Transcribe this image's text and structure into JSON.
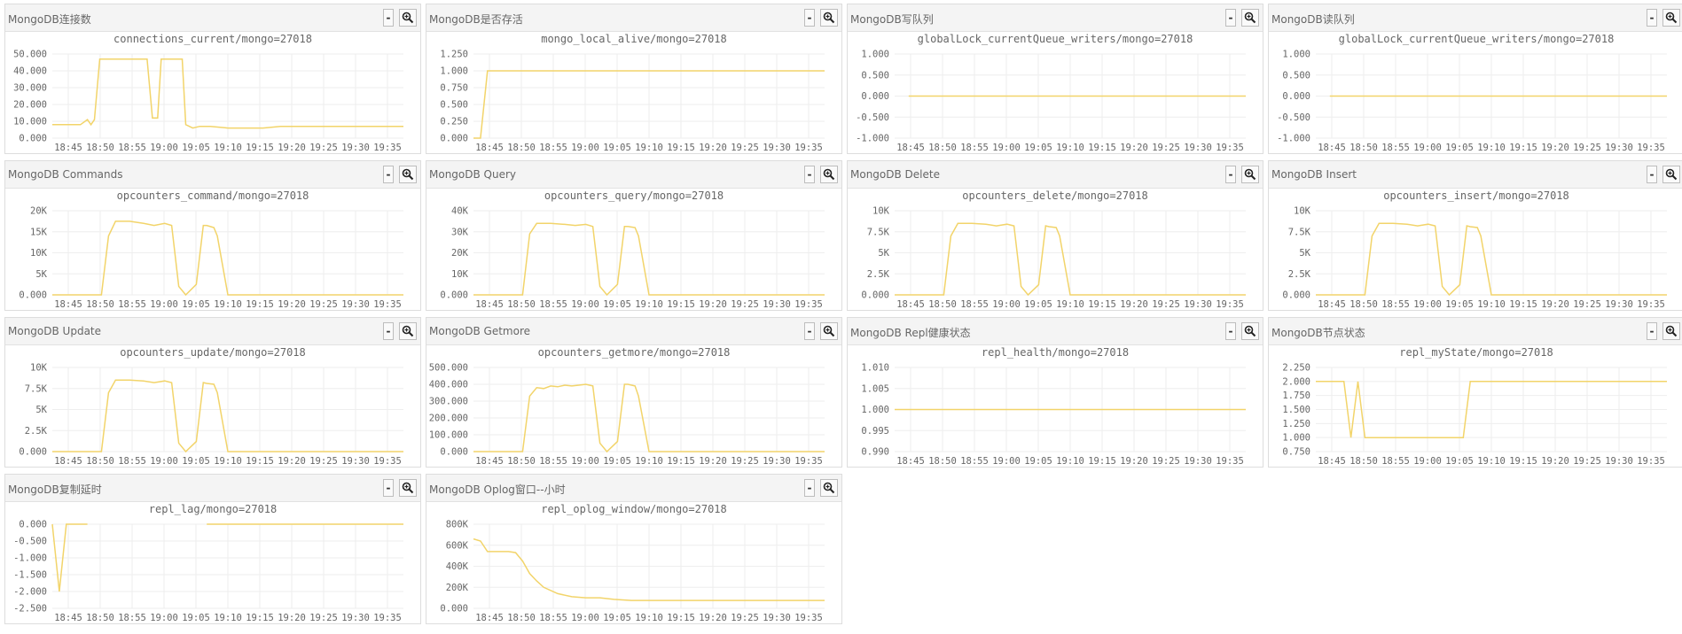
{
  "buttons": {
    "minimize_label": "-",
    "zoom_icon": "magnifier-icon"
  },
  "colors": {
    "line": "#f2d46a",
    "grid": "#eeeeee",
    "text": "#666666"
  },
  "chart_data": [
    {
      "title": "MongoDB连接数",
      "subtitle": "connections_current/mongo=27018",
      "type": "line",
      "yticks": [
        "50.000",
        "40.000",
        "30.000",
        "20.000",
        "10.000",
        "0.000"
      ],
      "ylim": [
        0,
        50
      ],
      "xticks": [
        "18:45",
        "18:50",
        "18:55",
        "19:00",
        "19:05",
        "19:10",
        "19:15",
        "19:20",
        "19:25",
        "19:30",
        "19:35"
      ],
      "x": [
        0,
        0.05,
        0.08,
        0.1,
        0.11,
        0.12,
        0.135,
        0.15,
        0.27,
        0.285,
        0.3,
        0.31,
        0.32,
        0.37,
        0.38,
        0.4,
        0.42,
        0.45,
        0.5,
        0.55,
        0.6,
        0.65,
        0.7,
        0.8,
        0.9,
        1
      ],
      "values": [
        8,
        8,
        8,
        11,
        8,
        11,
        47,
        47,
        47,
        12,
        12,
        47,
        47,
        47,
        8,
        6,
        7,
        7,
        6,
        6,
        6,
        7,
        7,
        7,
        7,
        7
      ]
    },
    {
      "title": "MongoDB是否存活",
      "subtitle": "mongo_local_alive/mongo=27018",
      "type": "line",
      "yticks": [
        "1.250",
        "1.000",
        "0.750",
        "0.500",
        "0.250",
        "0.000"
      ],
      "ylim": [
        0,
        1.25
      ],
      "xticks": [
        "18:45",
        "18:50",
        "18:55",
        "19:00",
        "19:05",
        "19:10",
        "19:15",
        "19:20",
        "19:25",
        "19:30",
        "19:35"
      ],
      "x": [
        0,
        0.02,
        0.04,
        1
      ],
      "values": [
        0,
        0,
        1,
        1
      ]
    },
    {
      "title": "MongoDB写队列",
      "subtitle": "globalLock_currentQueue_writers/mongo=27018",
      "type": "line",
      "yticks": [
        "1.000",
        "0.500",
        "0.000",
        "-0.500",
        "-1.000"
      ],
      "ylim": [
        -1,
        1
      ],
      "xticks": [
        "18:45",
        "18:50",
        "18:55",
        "19:00",
        "19:05",
        "19:10",
        "19:15",
        "19:20",
        "19:25",
        "19:30",
        "19:35"
      ],
      "x": [
        0.04,
        1
      ],
      "values": [
        0,
        0
      ]
    },
    {
      "title": "MongoDB读队列",
      "subtitle": "globalLock_currentQueue_writers/mongo=27018",
      "type": "line",
      "yticks": [
        "1.000",
        "0.500",
        "0.000",
        "-0.500",
        "-1.000"
      ],
      "ylim": [
        -1,
        1
      ],
      "xticks": [
        "18:45",
        "18:50",
        "18:55",
        "19:00",
        "19:05",
        "19:10",
        "19:15",
        "19:20",
        "19:25",
        "19:30",
        "19:35"
      ],
      "x": [
        0.04,
        1
      ],
      "values": [
        0,
        0
      ]
    },
    {
      "title": "MongoDB Commands",
      "subtitle": "opcounters_command/mongo=27018",
      "type": "line",
      "yticks": [
        "20K",
        "15K",
        "10K",
        "5K",
        "0.000"
      ],
      "ylim": [
        0,
        20000
      ],
      "xticks": [
        "18:45",
        "18:50",
        "18:55",
        "19:00",
        "19:05",
        "19:10",
        "19:15",
        "19:20",
        "19:25",
        "19:30",
        "19:35"
      ],
      "x": [
        0,
        0.14,
        0.16,
        0.18,
        0.22,
        0.26,
        0.29,
        0.32,
        0.34,
        0.36,
        0.38,
        0.41,
        0.43,
        0.44,
        0.46,
        0.47,
        0.5,
        0.6,
        0.7,
        0.8,
        0.9,
        1
      ],
      "values": [
        0,
        0,
        14000,
        17500,
        17500,
        17000,
        16500,
        17000,
        16500,
        2000,
        0,
        2500,
        16500,
        16500,
        16000,
        14000,
        0,
        0,
        0,
        0,
        0,
        0
      ]
    },
    {
      "title": "MongoDB Query",
      "subtitle": "opcounters_query/mongo=27018",
      "type": "line",
      "yticks": [
        "40K",
        "30K",
        "20K",
        "10K",
        "0.000"
      ],
      "ylim": [
        0,
        40000
      ],
      "xticks": [
        "18:45",
        "18:50",
        "18:55",
        "19:00",
        "19:05",
        "19:10",
        "19:15",
        "19:20",
        "19:25",
        "19:30",
        "19:35"
      ],
      "x": [
        0,
        0.14,
        0.16,
        0.18,
        0.22,
        0.26,
        0.29,
        0.32,
        0.34,
        0.36,
        0.38,
        0.41,
        0.43,
        0.44,
        0.46,
        0.47,
        0.5,
        0.6,
        0.7,
        0.8,
        0.9,
        1
      ],
      "values": [
        0,
        0,
        29000,
        34000,
        34000,
        33500,
        33000,
        33500,
        32500,
        4000,
        0,
        5000,
        32500,
        32500,
        32000,
        28000,
        0,
        0,
        0,
        0,
        0,
        0
      ]
    },
    {
      "title": "MongoDB Delete",
      "subtitle": "opcounters_delete/mongo=27018",
      "type": "line",
      "yticks": [
        "10K",
        "7.5K",
        "5K",
        "2.5K",
        "0.000"
      ],
      "ylim": [
        0,
        10000
      ],
      "xticks": [
        "18:45",
        "18:50",
        "18:55",
        "19:00",
        "19:05",
        "19:10",
        "19:15",
        "19:20",
        "19:25",
        "19:30",
        "19:35"
      ],
      "x": [
        0,
        0.14,
        0.16,
        0.18,
        0.22,
        0.26,
        0.29,
        0.32,
        0.34,
        0.36,
        0.38,
        0.41,
        0.43,
        0.44,
        0.46,
        0.47,
        0.5,
        0.6,
        0.7,
        0.8,
        0.9,
        1
      ],
      "values": [
        0,
        0,
        7000,
        8500,
        8500,
        8400,
        8200,
        8400,
        8200,
        1000,
        0,
        1200,
        8200,
        8100,
        8000,
        7000,
        0,
        0,
        0,
        0,
        0,
        0
      ]
    },
    {
      "title": "MongoDB Insert",
      "subtitle": "opcounters_insert/mongo=27018",
      "type": "line",
      "yticks": [
        "10K",
        "7.5K",
        "5K",
        "2.5K",
        "0.000"
      ],
      "ylim": [
        0,
        10000
      ],
      "xticks": [
        "18:45",
        "18:50",
        "18:55",
        "19:00",
        "19:05",
        "19:10",
        "19:15",
        "19:20",
        "19:25",
        "19:30",
        "19:35"
      ],
      "x": [
        0,
        0.14,
        0.16,
        0.18,
        0.22,
        0.26,
        0.29,
        0.32,
        0.34,
        0.36,
        0.38,
        0.41,
        0.43,
        0.44,
        0.46,
        0.47,
        0.5,
        0.6,
        0.7,
        0.8,
        0.9,
        1
      ],
      "values": [
        0,
        0,
        7000,
        8500,
        8500,
        8400,
        8200,
        8400,
        8200,
        1000,
        0,
        1200,
        8200,
        8100,
        8000,
        7000,
        0,
        0,
        0,
        0,
        0,
        0
      ]
    },
    {
      "title": "MongoDB Update",
      "subtitle": "opcounters_update/mongo=27018",
      "type": "line",
      "yticks": [
        "10K",
        "7.5K",
        "5K",
        "2.5K",
        "0.000"
      ],
      "ylim": [
        0,
        10000
      ],
      "xticks": [
        "18:45",
        "18:50",
        "18:55",
        "19:00",
        "19:05",
        "19:10",
        "19:15",
        "19:20",
        "19:25",
        "19:30",
        "19:35"
      ],
      "x": [
        0,
        0.14,
        0.16,
        0.18,
        0.22,
        0.26,
        0.29,
        0.32,
        0.34,
        0.36,
        0.38,
        0.41,
        0.43,
        0.44,
        0.46,
        0.47,
        0.5,
        0.6,
        0.7,
        0.8,
        0.9,
        1
      ],
      "values": [
        0,
        0,
        7000,
        8500,
        8500,
        8400,
        8200,
        8400,
        8200,
        1000,
        0,
        1200,
        8200,
        8100,
        8000,
        7000,
        0,
        0,
        0,
        0,
        0,
        0
      ]
    },
    {
      "title": "MongoDB Getmore",
      "subtitle": "opcounters_getmore/mongo=27018",
      "type": "line",
      "yticks": [
        "500.000",
        "400.000",
        "300.000",
        "200.000",
        "100.000",
        "0.000"
      ],
      "ylim": [
        0,
        500
      ],
      "xticks": [
        "18:45",
        "18:50",
        "18:55",
        "19:00",
        "19:05",
        "19:10",
        "19:15",
        "19:20",
        "19:25",
        "19:30",
        "19:35"
      ],
      "x": [
        0,
        0.14,
        0.16,
        0.18,
        0.2,
        0.22,
        0.24,
        0.26,
        0.28,
        0.3,
        0.32,
        0.34,
        0.36,
        0.38,
        0.41,
        0.43,
        0.44,
        0.46,
        0.47,
        0.5,
        0.6,
        0.7,
        0.8,
        0.9,
        1
      ],
      "values": [
        0,
        0,
        330,
        380,
        375,
        390,
        385,
        395,
        390,
        395,
        400,
        390,
        50,
        0,
        60,
        400,
        400,
        390,
        330,
        0,
        0,
        0,
        0,
        0,
        0
      ]
    },
    {
      "title": "MongoDB Repl健康状态",
      "subtitle": "repl_health/mongo=27018",
      "type": "line",
      "yticks": [
        "1.010",
        "1.005",
        "1.000",
        "0.995",
        "0.990"
      ],
      "ylim": [
        0.99,
        1.01
      ],
      "xticks": [
        "18:45",
        "18:50",
        "18:55",
        "19:00",
        "19:05",
        "19:10",
        "19:15",
        "19:20",
        "19:25",
        "19:30",
        "19:35"
      ],
      "x": [
        0,
        1
      ],
      "values": [
        1,
        1
      ]
    },
    {
      "title": "MongoDB节点状态",
      "subtitle": "repl_myState/mongo=27018",
      "type": "line",
      "yticks": [
        "2.250",
        "2.000",
        "1.750",
        "1.500",
        "1.250",
        "1.000",
        "0.750"
      ],
      "ylim": [
        0.75,
        2.25
      ],
      "xticks": [
        "18:45",
        "18:50",
        "18:55",
        "19:00",
        "19:05",
        "19:10",
        "19:15",
        "19:20",
        "19:25",
        "19:30",
        "19:35"
      ],
      "x": [
        0,
        0.08,
        0.1,
        0.12,
        0.14,
        0.2,
        0.3,
        0.4,
        0.42,
        0.44,
        0.5,
        0.6,
        0.7,
        0.8,
        0.9,
        1
      ],
      "values": [
        2,
        2,
        1,
        2,
        1,
        1,
        1,
        1,
        1,
        2,
        2,
        2,
        2,
        2,
        2,
        2
      ]
    },
    {
      "title": "MongoDB复制延时",
      "subtitle": "repl_lag/mongo=27018",
      "type": "line",
      "yticks": [
        "0.000",
        "-0.500",
        "-1.000",
        "-1.500",
        "-2.000",
        "-2.500"
      ],
      "ylim": [
        -2.5,
        0
      ],
      "xticks": [
        "18:45",
        "18:50",
        "18:55",
        "19:00",
        "19:05",
        "19:10",
        "19:15",
        "19:20",
        "19:25",
        "19:30",
        "19:35"
      ],
      "segments": [
        {
          "x": [
            0,
            0.02,
            0.04,
            0.1
          ],
          "values": [
            0,
            -2,
            0,
            0
          ]
        },
        {
          "x": [
            0.44,
            1
          ],
          "values": [
            0,
            0
          ]
        }
      ]
    },
    {
      "title": "MongoDB Oplog窗口--小时",
      "subtitle": "repl_oplog_window/mongo=27018",
      "type": "line",
      "yticks": [
        "800K",
        "600K",
        "400K",
        "200K",
        "0.000"
      ],
      "ylim": [
        0,
        800000
      ],
      "xticks": [
        "18:45",
        "18:50",
        "18:55",
        "19:00",
        "19:05",
        "19:10",
        "19:15",
        "19:20",
        "19:25",
        "19:30",
        "19:35"
      ],
      "x": [
        0,
        0.02,
        0.04,
        0.06,
        0.1,
        0.12,
        0.14,
        0.16,
        0.18,
        0.2,
        0.24,
        0.28,
        0.32,
        0.36,
        0.4,
        0.45,
        0.5,
        0.6,
        0.7,
        0.8,
        0.9,
        1
      ],
      "values": [
        660000,
        640000,
        540000,
        540000,
        540000,
        530000,
        450000,
        330000,
        260000,
        200000,
        140000,
        110000,
        100000,
        100000,
        85000,
        75000,
        75000,
        75000,
        75000,
        75000,
        75000,
        75000
      ]
    }
  ]
}
